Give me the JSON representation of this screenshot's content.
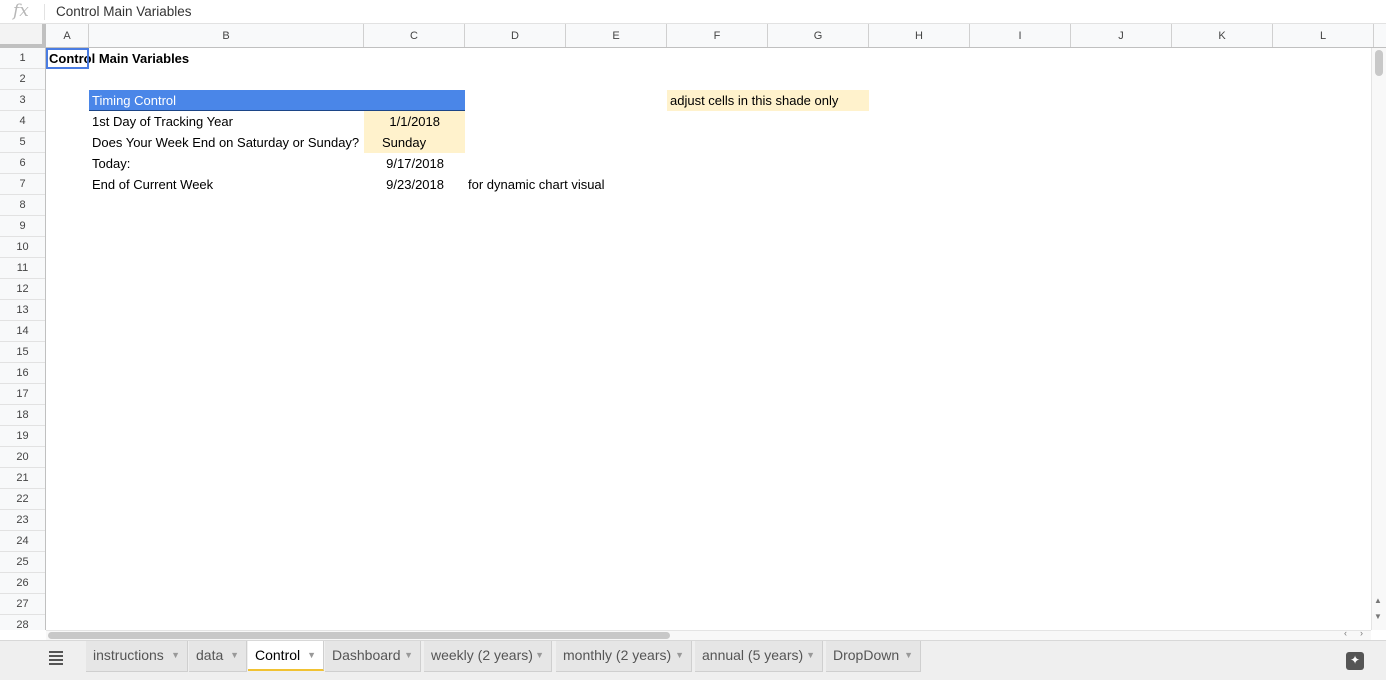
{
  "formula_bar": {
    "fx_label": "fx",
    "content": "Control Main Variables"
  },
  "columns": [
    {
      "label": "A"
    },
    {
      "label": "B"
    },
    {
      "label": "C"
    },
    {
      "label": "D"
    },
    {
      "label": "E"
    },
    {
      "label": "F"
    },
    {
      "label": "G"
    },
    {
      "label": "H"
    },
    {
      "label": "I"
    },
    {
      "label": "J"
    },
    {
      "label": "K"
    },
    {
      "label": "L"
    }
  ],
  "rows": [
    "1",
    "2",
    "3",
    "4",
    "5",
    "6",
    "7",
    "8",
    "9",
    "10",
    "11",
    "12",
    "13",
    "14",
    "15",
    "16",
    "17",
    "18",
    "19",
    "20",
    "21",
    "22",
    "23",
    "24",
    "25",
    "26",
    "27",
    "28"
  ],
  "cells": {
    "a1": "Control Main Variables",
    "b3": "Timing Control",
    "b4": "1st Day of Tracking Year",
    "c4": "1/1/2018",
    "b5": "Does Your Week End on Saturday or Sunday?",
    "c5": "Sunday",
    "b6": "Today:",
    "c6": "9/17/2018",
    "b7": "End of Current Week",
    "c7": "9/23/2018",
    "d7": "for dynamic chart visual",
    "f3": "adjust cells in this shade only"
  },
  "colors": {
    "header_blue": "#4a86e8",
    "input_shade": "#fff2cc",
    "selection": "#4a7ce2",
    "active_tab_underline": "#f1c232"
  },
  "scroll": {
    "left_arrow": "‹",
    "right_arrow": "›",
    "up_arrow": "▲",
    "down_arrow": "▼"
  },
  "tabs": [
    {
      "label": "instructions",
      "active": false
    },
    {
      "label": "data",
      "active": false
    },
    {
      "label": "Control",
      "active": true
    },
    {
      "label": "Dashboard",
      "active": false
    },
    {
      "label": "weekly (2 years)",
      "active": false
    },
    {
      "label": "monthly (2 years)",
      "active": false
    },
    {
      "label": "annual (5 years)",
      "active": false
    },
    {
      "label": "DropDown",
      "active": false
    }
  ],
  "icons": {
    "sheets_menu": "all-sheets-icon",
    "explore": "explore-icon",
    "tab_menu": "chevron-down-icon"
  }
}
